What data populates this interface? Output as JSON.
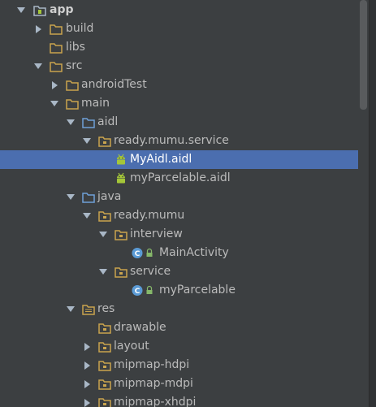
{
  "project_tree": {
    "nodes": [
      {
        "label": "app",
        "icon": "module-folder-icon",
        "arrow": "down"
      },
      {
        "label": "build",
        "icon": "folder-icon",
        "arrow": "right"
      },
      {
        "label": "libs",
        "icon": "folder-icon",
        "arrow": "none"
      },
      {
        "label": "src",
        "icon": "folder-icon",
        "arrow": "down"
      },
      {
        "label": "androidTest",
        "icon": "folder-icon",
        "arrow": "right"
      },
      {
        "label": "main",
        "icon": "folder-icon",
        "arrow": "down"
      },
      {
        "label": "aidl",
        "icon": "source-folder-icon",
        "arrow": "down"
      },
      {
        "label": "ready.mumu.service",
        "icon": "package-icon",
        "arrow": "down"
      },
      {
        "label": "MyAidl.aidl",
        "icon": "android-file-icon",
        "arrow": "none",
        "selected": true
      },
      {
        "label": "myParcelable.aidl",
        "icon": "android-file-icon",
        "arrow": "none"
      },
      {
        "label": "java",
        "icon": "source-folder-icon",
        "arrow": "down"
      },
      {
        "label": "ready.mumu",
        "icon": "package-icon",
        "arrow": "down"
      },
      {
        "label": "interview",
        "icon": "package-icon",
        "arrow": "down"
      },
      {
        "label": "MainActivity",
        "icon": "class-icon",
        "arrow": "none"
      },
      {
        "label": "service",
        "icon": "package-icon",
        "arrow": "down"
      },
      {
        "label": "myParcelable",
        "icon": "class-icon",
        "arrow": "none"
      },
      {
        "label": "res",
        "icon": "resource-folder-icon",
        "arrow": "down"
      },
      {
        "label": "drawable",
        "icon": "package-icon",
        "arrow": "none"
      },
      {
        "label": "layout",
        "icon": "package-icon",
        "arrow": "right"
      },
      {
        "label": "mipmap-hdpi",
        "icon": "package-icon",
        "arrow": "right"
      },
      {
        "label": "mipmap-mdpi",
        "icon": "package-icon",
        "arrow": "right"
      },
      {
        "label": "mipmap-xhdpi",
        "icon": "package-icon",
        "arrow": "right"
      }
    ]
  },
  "colors": {
    "background": "#3c3f41",
    "selection": "#4b6eaf",
    "text": "#bbbbbb",
    "folder": "#c9a44e",
    "android": "#a4c639",
    "class_badge": "#5b9bd5"
  }
}
